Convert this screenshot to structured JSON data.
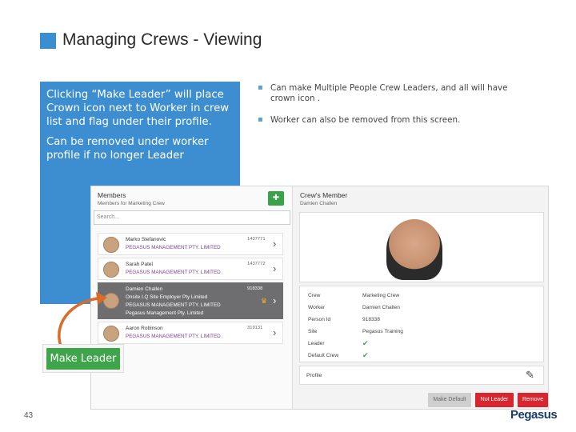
{
  "title": "Managing Crews - Viewing",
  "callout": {
    "para1": "Clicking  “Make Leader”  will place Crown icon next to Worker in crew list and flag under their profile.",
    "para2": "Can be removed under worker profile if no longer Leader"
  },
  "bullets": [
    "Can make Multiple People Crew Leaders, and all will have crown icon .",
    "Worker can also be removed from this  screen."
  ],
  "members_panel": {
    "title": "Members",
    "subtitle": "Members for Marketing Crew",
    "search_placeholder": "Search...",
    "rows": [
      {
        "name": "Marko Stefanovic",
        "company": "PEGASUS MANAGEMENT PTY. LIMITED",
        "id": "1437771"
      },
      {
        "name": "Sarah Patel",
        "company": "PEGASUS MANAGEMENT PTY. LIMITED",
        "id": "1437772"
      },
      {
        "name": "Damien Challen",
        "company": "Onsite I.Q Site Employer Pty Limited",
        "company2": "PEGASUS MANAGEMENT PTY. LIMITED",
        "company3": "Pegasus Management Pty. Limited",
        "id": "918338"
      },
      {
        "name": "Aaron Robinson",
        "company": "PEGASUS MANAGEMENT PTY. LIMITED",
        "id": "319131"
      }
    ]
  },
  "crew_member_panel": {
    "title": "Crew's Member",
    "subtitle": "Damien Challen",
    "labels": {
      "crew": "Crew",
      "worker": "Worker",
      "person_id": "Person Id",
      "site": "Site",
      "leader": "Leader",
      "default_crew": "Default Crew"
    },
    "values": {
      "crew": "Marketing Crew",
      "worker": "Damien Challen",
      "person_id": "918338",
      "site": "Pegasus Training"
    },
    "profile_label": "Profile"
  },
  "buttons": {
    "make_default": "Make Default",
    "not_leader": "Not Leader",
    "remove": "Remove",
    "make_leader": "Make Leader"
  },
  "page_number": "43",
  "logo_text": "Pegasus"
}
